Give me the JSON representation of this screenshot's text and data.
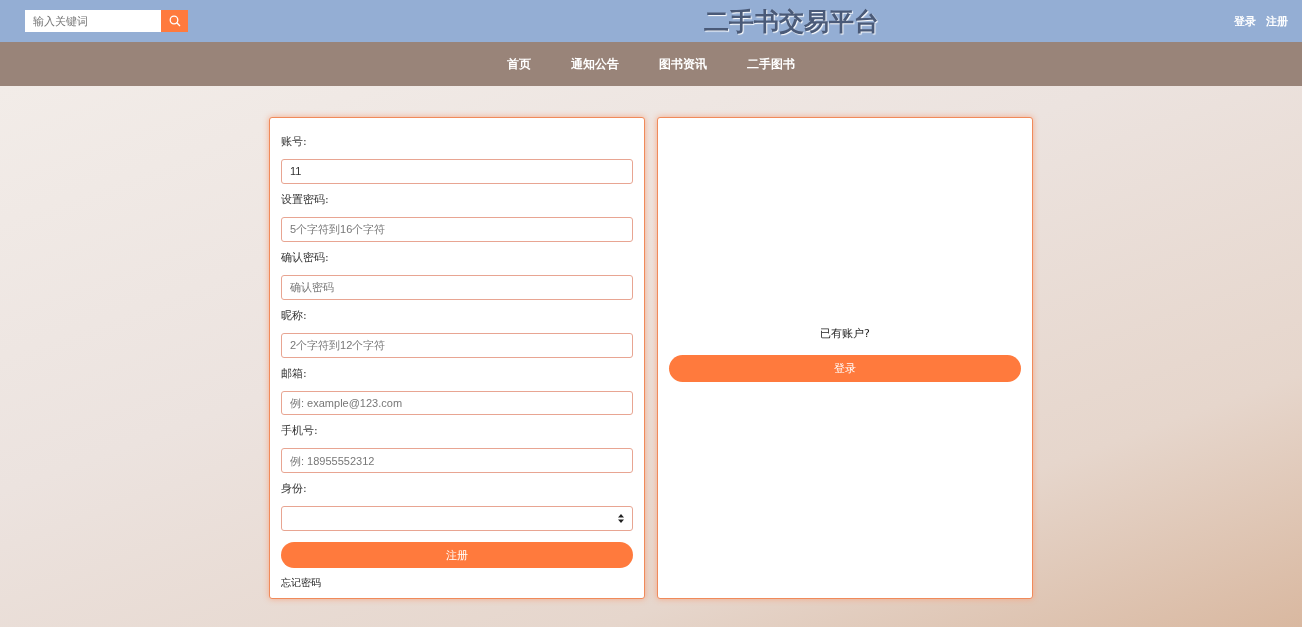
{
  "header": {
    "search": {
      "placeholder": "输入关键词"
    },
    "title": "二手书交易平台",
    "links": [
      "登录",
      "注册"
    ]
  },
  "nav": {
    "items": [
      "首页",
      "通知公告",
      "图书资讯",
      "二手图书"
    ]
  },
  "register_form": {
    "fields": [
      {
        "kind": "text",
        "label": "账号:",
        "value": "11"
      },
      {
        "kind": "text",
        "label": "设置密码:",
        "placeholder": "5个字符到16个字符"
      },
      {
        "kind": "text",
        "label": "确认密码:",
        "placeholder": "确认密码"
      },
      {
        "kind": "text",
        "label": "昵称:",
        "placeholder": "2个字符到12个字符"
      },
      {
        "kind": "text",
        "label": "邮箱:",
        "placeholder": "例: example@123.com"
      },
      {
        "kind": "text",
        "label": "手机号:",
        "placeholder": "例: 18955552312"
      },
      {
        "kind": "select",
        "label": "身份:"
      }
    ],
    "submit": "注册",
    "forgot_link": "忘记密码"
  },
  "login_panel": {
    "prompt": "已有账户?",
    "button": "登录"
  }
}
